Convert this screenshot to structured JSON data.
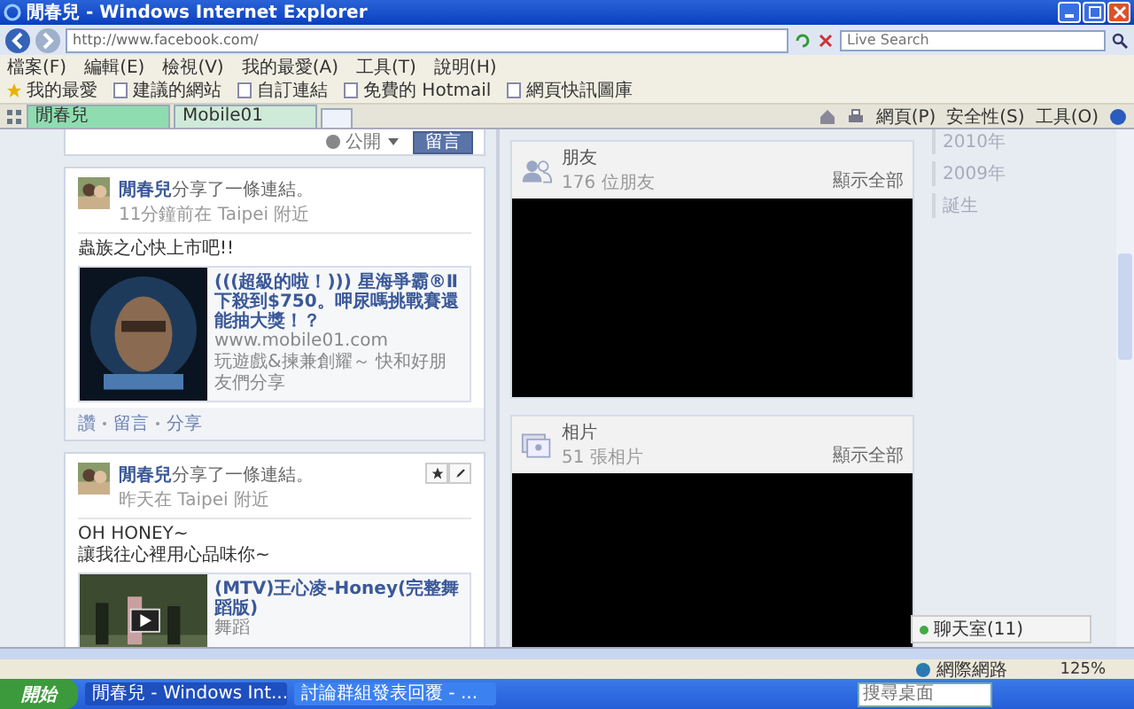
{
  "window": {
    "title": "閒春兒 - Windows Internet Explorer"
  },
  "address_bar": {
    "url": "http://www.facebook.com/",
    "search_placeholder": "Live Search"
  },
  "menu": [
    "檔案(F)",
    "編輯(E)",
    "檢視(V)",
    "我的最愛(A)",
    "工具(T)",
    "說明(H)"
  ],
  "favorites_bar": {
    "label": "我的最愛",
    "links": [
      "建議的網站",
      "自訂連結",
      "免費的 Hotmail",
      "網頁快訊圖庫"
    ]
  },
  "tabs": [
    {
      "label": "閒春兒",
      "selected": true
    },
    {
      "label": "Mobile01",
      "selected": false
    }
  ],
  "command_bar": [
    "網頁(P)",
    "安全性(S)",
    "工具(O)"
  ],
  "composer": {
    "privacy": "公開",
    "button": "留言"
  },
  "posts": [
    {
      "author": "閒春兒",
      "action": "分享了一條連結。",
      "meta": "11分鐘前在 Taipei 附近",
      "hover_controls": false,
      "text": [
        "蟲族之心快上市吧!!"
      ],
      "link": {
        "title": "(((超級的啦！))) 星海爭霸®Ⅱ下殺到$750。呷尿嗎挑戰賽還能抽大獎！？",
        "domain": "www.mobile01.com",
        "description": "玩遊戲&揀兼創耀～ 快和好朋友們分享",
        "video": false
      },
      "actions": [
        "讚",
        "留言",
        "分享"
      ]
    },
    {
      "author": "閒春兒",
      "action": "分享了一條連結。",
      "meta": "昨天在 Taipei 附近",
      "hover_controls": true,
      "text": [
        "OH HONEY~",
        "讓我往心裡用心品味你~"
      ],
      "link": {
        "title": "(MTV)王心凌-Honey(完整舞蹈版)",
        "description": "舞蹈",
        "video": true
      }
    }
  ],
  "friends": {
    "title": "朋友",
    "count": "176 位朋友",
    "show_all": "顯示全部"
  },
  "photos": {
    "title": "相片",
    "count": "51 張相片",
    "show_all": "顯示全部"
  },
  "timeline_nav": [
    "2010年",
    "2009年",
    "誕生"
  ],
  "chat": {
    "label": "聊天室(11)"
  },
  "status_bar": {
    "zone": "網際網路",
    "zoom": "125%"
  },
  "taskbar": {
    "start": "開始",
    "windows": [
      {
        "label": "閒春兒 - Windows Int...",
        "selected": true
      },
      {
        "label": "討論群組發表回覆 - ...",
        "selected": false
      }
    ],
    "search_placeholder": "搜尋桌面"
  }
}
